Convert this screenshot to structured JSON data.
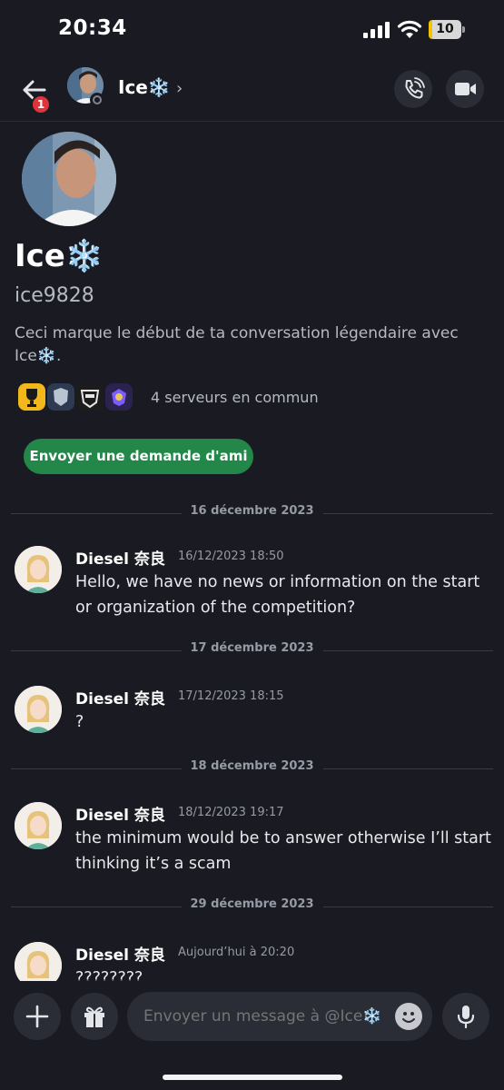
{
  "status_bar": {
    "time": "20:34",
    "battery": "10",
    "battery_level": 0.1
  },
  "header": {
    "name": "Ice❄️",
    "badge_count": "1",
    "icons": [
      "back-arrow-icon",
      "phone-icon",
      "video-camera-icon"
    ]
  },
  "profile": {
    "display_name": "Ice❄️",
    "username": "ice9828",
    "intro": "Ceci marque le début de ta conversation légendaire avec Ice❄️.",
    "mutual_servers": "4 serveurs en commun",
    "friend_button": "Envoyer une demande d'ami"
  },
  "messages": [
    {
      "date": "16 décembre 2023",
      "author": "Diesel 奈良",
      "time": "16/12/2023 18:50",
      "text": "Hello, we have no news or information on the start or organization of the competition?"
    },
    {
      "date": "17 décembre 2023",
      "author": "Diesel 奈良",
      "time": "17/12/2023 18:15",
      "text": "?"
    },
    {
      "date": "18 décembre 2023",
      "author": "Diesel 奈良",
      "time": "18/12/2023 19:17",
      "text": "the minimum would be to answer otherwise I’ll start thinking it’s a scam"
    },
    {
      "date": "29 décembre 2023",
      "author": "Diesel 奈良",
      "time": "Aujourd’hui à 20:20",
      "text": "????????"
    }
  ],
  "composer": {
    "placeholder": "Envoyer un message à @Ice❄️",
    "icons": [
      "plus-icon",
      "gift-icon",
      "emoji-icon",
      "microphone-icon"
    ]
  },
  "colors": {
    "background": "#1a1b22",
    "friend_button": "#23874a",
    "badge": "#e0343a"
  }
}
